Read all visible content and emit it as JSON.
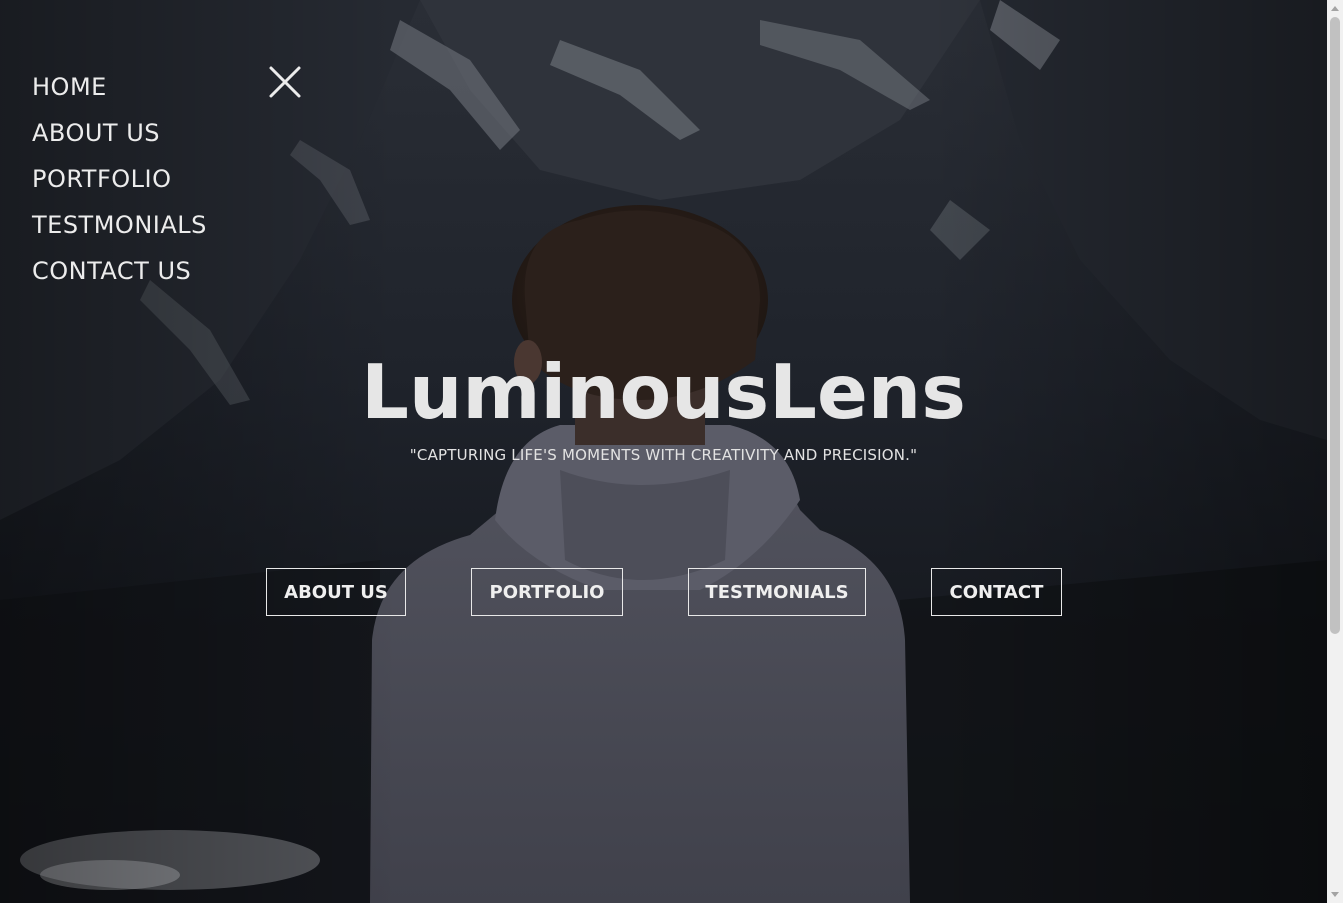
{
  "site": {
    "title": "LuminousLens",
    "tagline": "\"CAPTURING LIFE'S MOMENTS WITH CREATIVITY AND PRECISION.\""
  },
  "side_nav": {
    "items": [
      {
        "label": "HOME"
      },
      {
        "label": "ABOUT US"
      },
      {
        "label": "PORTFOLIO"
      },
      {
        "label": "TESTMONIALS"
      },
      {
        "label": "CONTACT US"
      }
    ],
    "close_icon": "close-icon"
  },
  "buttons": {
    "about": "ABOUT US",
    "portfolio": "PORTFOLIO",
    "testimonials": "TESTMONIALS",
    "contact": "CONTACT"
  },
  "colors": {
    "text": "#ececec",
    "button_border": "#e8e8e8"
  }
}
